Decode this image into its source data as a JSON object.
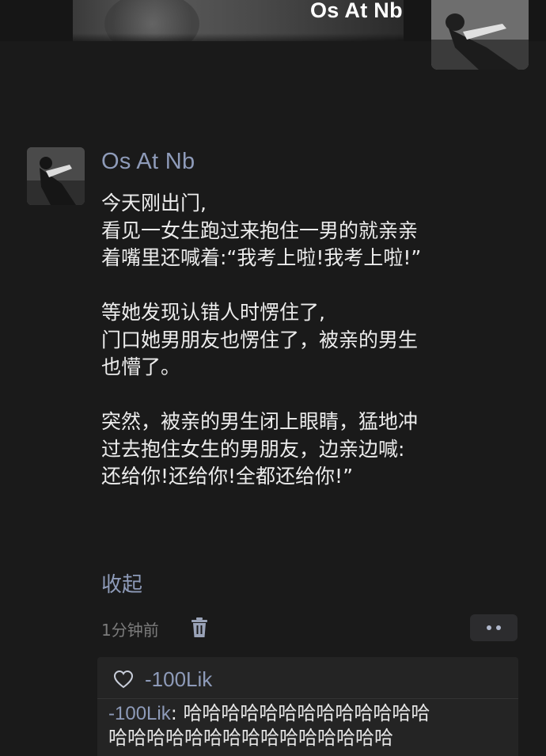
{
  "profile": {
    "name": "Os At Nb"
  },
  "post": {
    "author": "Os At Nb",
    "lines": [
      "今天刚出门,",
      "看见一女生跑过来抱住一男的就亲亲",
      "着嘴里还喊着:“我考上啦!我考上啦!”",
      "",
      "等她发现认错人时愣住了,",
      "门口她男朋友也愣住了，被亲的男生",
      "也懵了。",
      "",
      "突然，被亲的男生闭上眼睛，猛地冲",
      "过去抱住女生的男朋友，边亲边喊:",
      "还给你!还给你!全都还给你!”"
    ],
    "collapse_label": "收起",
    "timestamp": "1分钟前"
  },
  "feedback": {
    "likes": [
      "-100Lik"
    ],
    "comments": [
      {
        "author": "-100Lik",
        "separator": ": ",
        "text_line1": "哈哈哈哈哈哈哈哈哈哈哈哈哈",
        "text_line2": "哈哈哈哈哈哈哈哈哈哈哈哈哈哈哈"
      }
    ]
  },
  "colors": {
    "background": "#1a1a1a",
    "link_blue": "#8e9bb9",
    "text": "#ececec",
    "muted": "#7c7c7c",
    "panel": "#242424"
  },
  "icons": {
    "trash": "trash-icon",
    "more": "more-dots-icon",
    "heart": "heart-outline-icon"
  }
}
